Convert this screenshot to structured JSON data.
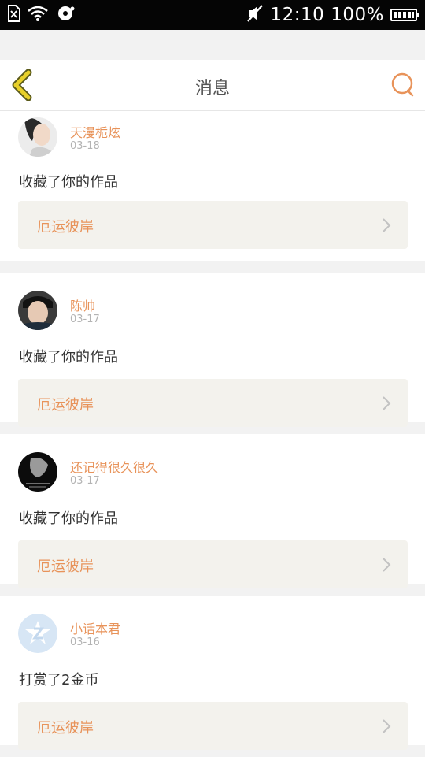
{
  "status_bar": {
    "time": "12:10",
    "battery_percent": "100%",
    "battery_level": 1.0,
    "left_icons": [
      "sim-error-icon",
      "wifi-icon",
      "disc-icon"
    ],
    "right_icons": [
      "mute-icon",
      "battery-icon"
    ]
  },
  "header": {
    "title": "消息",
    "back_icon": "chevron-left-icon",
    "search_icon": "search-icon"
  },
  "colors": {
    "accent": "#e8935a",
    "back_icon_fill": "#e8d02a",
    "card_box": "#f3f2ed",
    "background": "#f2f2f2"
  },
  "messages": [
    {
      "username": "天漫栀炫",
      "date": "03-18",
      "action": "收藏了你的作品",
      "work": "厄运彼岸"
    },
    {
      "username": "陈帅",
      "date": "03-17",
      "action": "收藏了你的作品",
      "work": "厄运彼岸"
    },
    {
      "username": "还记得很久很久",
      "date": "03-17",
      "action": "收藏了你的作品",
      "work": "厄运彼岸"
    },
    {
      "username": "小话本君",
      "date": "03-16",
      "action": "打赏了2金币",
      "work": "厄运彼岸"
    }
  ]
}
